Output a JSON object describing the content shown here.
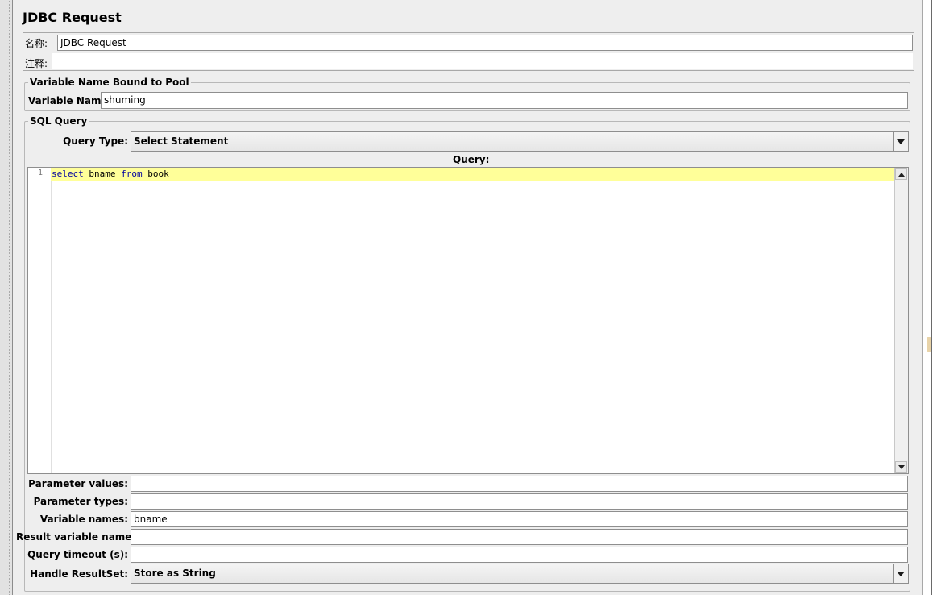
{
  "title": "JDBC Request",
  "name_label": "名称:",
  "name_value": "JDBC Request",
  "comment_label": "注释:",
  "comment_value": "",
  "pool_group": {
    "legend": "Variable Name Bound to Pool",
    "label": "Variable Name:",
    "value": "shuming"
  },
  "sql_group": {
    "legend": "SQL Query",
    "query_type_label": "Query Type:",
    "query_type_value": "Select Statement",
    "query_label": "Query:",
    "editor": {
      "line_number": "1",
      "kw1": "select",
      "t1": " bname ",
      "kw2": "from",
      "t2": " book"
    }
  },
  "params": {
    "parameter_values_label": "Parameter values:",
    "parameter_values": "",
    "parameter_types_label": "Parameter types:",
    "parameter_types": "",
    "variable_names_label": "Variable names:",
    "variable_names": "bname",
    "result_variable_label": "Result variable name:",
    "result_variable": "",
    "query_timeout_label": "Query timeout (s):",
    "query_timeout": "",
    "handle_resultset_label": "Handle ResultSet:",
    "handle_resultset_value": "Store as String"
  },
  "colors": {
    "background": "#eeeeee",
    "current_line": "#ffff99",
    "keyword": "#0000a0"
  }
}
